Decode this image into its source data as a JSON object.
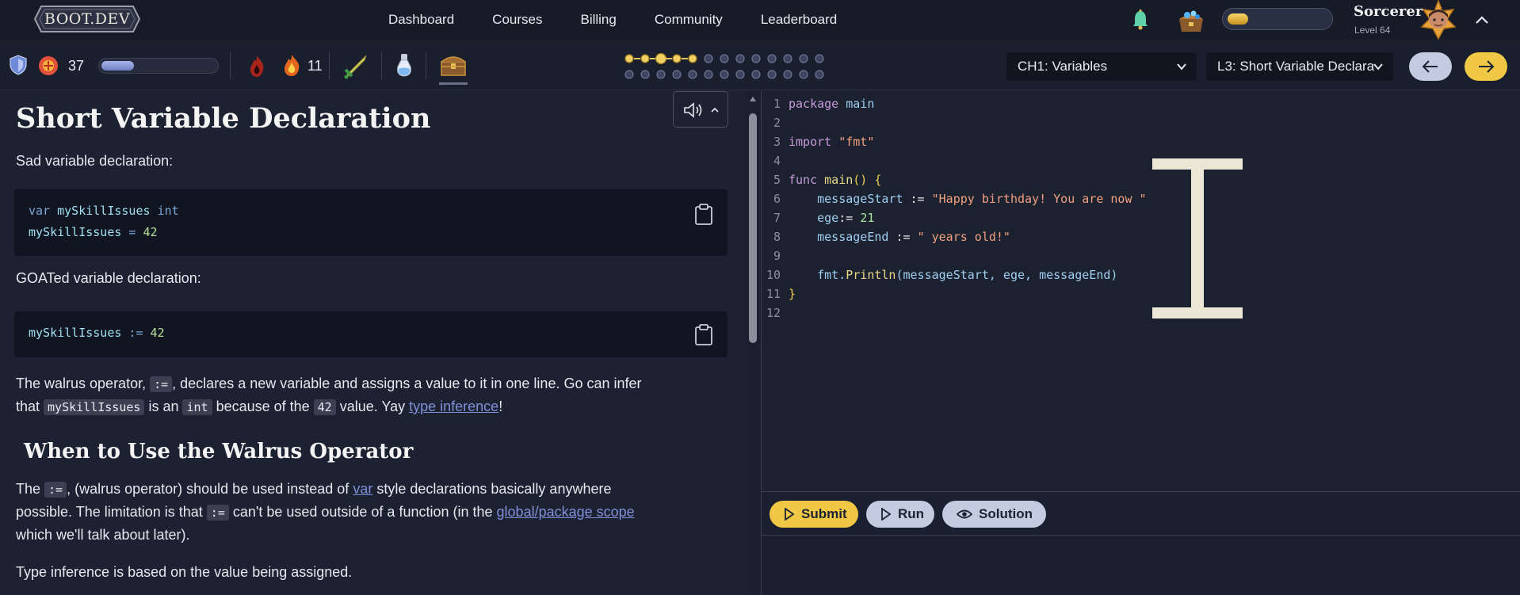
{
  "nav": {
    "logo_text": "BOOT.DEV",
    "links": [
      "Dashboard",
      "Courses",
      "Billing",
      "Community",
      "Leaderboard"
    ],
    "user_name": "Sorcerer",
    "user_level": "Level 64"
  },
  "toolbar": {
    "streak_count": "37",
    "flame_count": "11",
    "xp_progress": 0.28,
    "chapter_select": "CH1: Variables",
    "lesson_select": "L3: Short Variable Declara",
    "progress_dots_done": 5,
    "progress_dots_total": 26
  },
  "lesson": {
    "title": "Short Variable Declaration",
    "p1": "Sad variable declaration:",
    "code1": {
      "line1_kw": "var",
      "line1_var": " mySkillIssues",
      "line1_type": " int",
      "line2_var": "mySkillIssues",
      "line2_op": " = ",
      "line2_num": "42"
    },
    "p2": "GOATed variable declaration:",
    "code2": {
      "var": "mySkillIssues",
      "op": " := ",
      "num": "42"
    },
    "p3": {
      "t1": "The walrus operator, ",
      "c1": ":=",
      "t2": ", declares a new variable and assigns a value to it in one line. Go can infer",
      "t3": "that ",
      "c2": "mySkillIssues",
      "t4": " is an ",
      "c3": "int",
      "t5": " because of the ",
      "c4": "42",
      "t6": " value. Yay ",
      "link": "type inference",
      "t7": "!"
    },
    "h2": "When to Use the Walrus Operator",
    "p4": {
      "t1": "The ",
      "c1": ":=",
      "t2": ", (walrus operator) should be used instead of ",
      "link1": "var",
      "t3": " style declarations basically anywhere",
      "t4": "possible. The limitation is that ",
      "c2": ":=",
      "t5": " can't be used outside of a function (in the ",
      "link2": "global/package scope",
      "t6": "which we'll talk about later)."
    },
    "p5": "Type inference is based on the value being assigned."
  },
  "editor": {
    "lines": [
      "1",
      "2",
      "3",
      "4",
      "5",
      "6",
      "7",
      "8",
      "9",
      "10",
      "11",
      "12"
    ],
    "l1_kw": "package",
    "l1_id": " main",
    "l3_kw": "import",
    "l3_str": " \"fmt\"",
    "l5_kw": "func",
    "l5_fn": " main",
    "l5_rest": "() {",
    "l6_var": "    messageStart",
    "l6_op": " := ",
    "l6_str": "\"Happy birthday! You are now \"",
    "l7_var": "    ege",
    "l7_op": ":= ",
    "l7_num": "21",
    "l8_var": "    messageEnd",
    "l8_op": " := ",
    "l8_str": "\" years old!\"",
    "l10_pkg": "    fmt.",
    "l10_fn": "Println",
    "l10_args": "(messageStart, ege, messageEnd)",
    "l11": "}"
  },
  "actions": {
    "submit": "Submit",
    "run": "Run",
    "solution": "Solution"
  },
  "colors": {
    "accent_gold": "#f0c845",
    "button_gray": "#c3cbe0",
    "bg": "#1c2130"
  }
}
